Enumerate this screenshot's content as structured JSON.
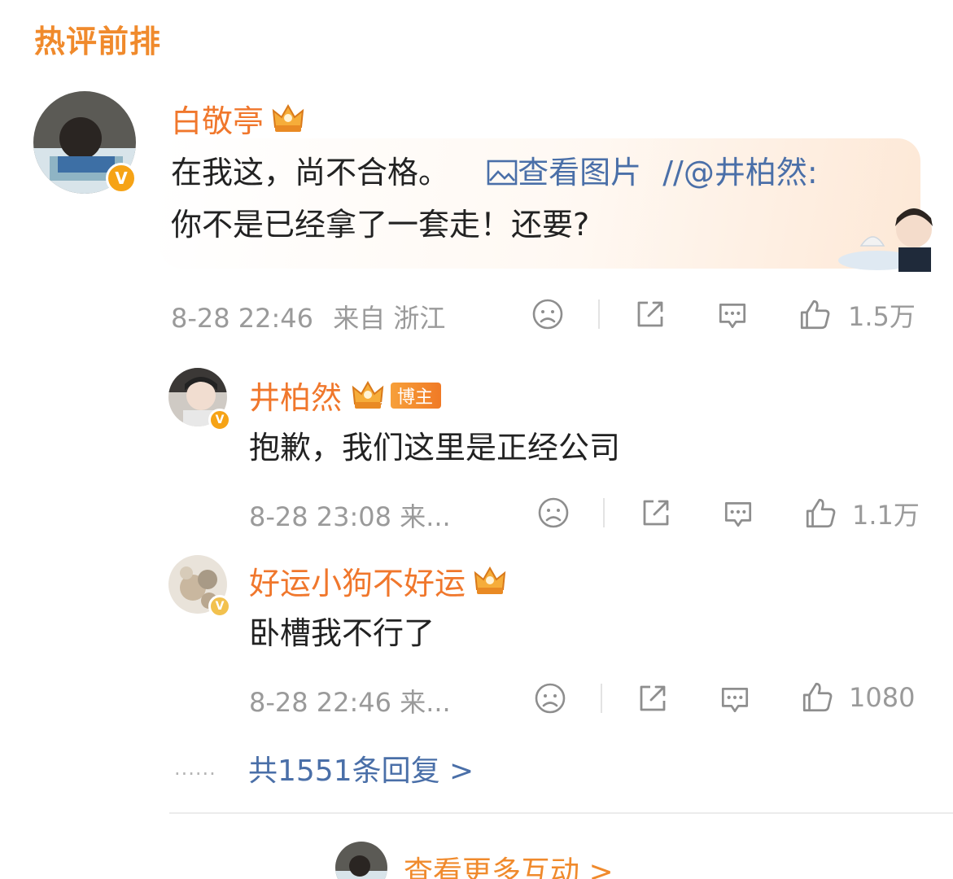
{
  "section_title": "热评前排",
  "main_comment": {
    "username": "白敬亭",
    "crown_level": "9",
    "text_part1": "在我这，尚不合格。",
    "view_image": "查看图片",
    "repost_mention": "//@井柏然:",
    "text_line2": "你不是已经拿了一套走！还要?",
    "timestamp": "8-28 22:46",
    "source": "来自 浙江",
    "likes": "1.5万"
  },
  "replies": [
    {
      "username": "井柏然",
      "crown_level": "10",
      "tag": "博主",
      "text": "抱歉，我们这里是正经公司",
      "meta": "8-28 23:08 来...",
      "likes": "1.1万"
    },
    {
      "username": "好运小狗不好运",
      "crown_level": "6",
      "text": "卧槽我不行了",
      "meta": "8-28 22:46 来...",
      "likes": "1080"
    }
  ],
  "dots": "......",
  "total_replies": "共1551条回复 >",
  "view_more_interactions": "查看更多互动 >",
  "colors": {
    "accent": "#f08a2c",
    "username": "#f0772c",
    "link": "#4a6fa8",
    "muted": "#9a9a9a"
  },
  "icons": [
    "dislike-icon",
    "share-icon",
    "comment-icon",
    "like-icon",
    "picture-icon",
    "crown-icon",
    "verified-badge-icon"
  ]
}
